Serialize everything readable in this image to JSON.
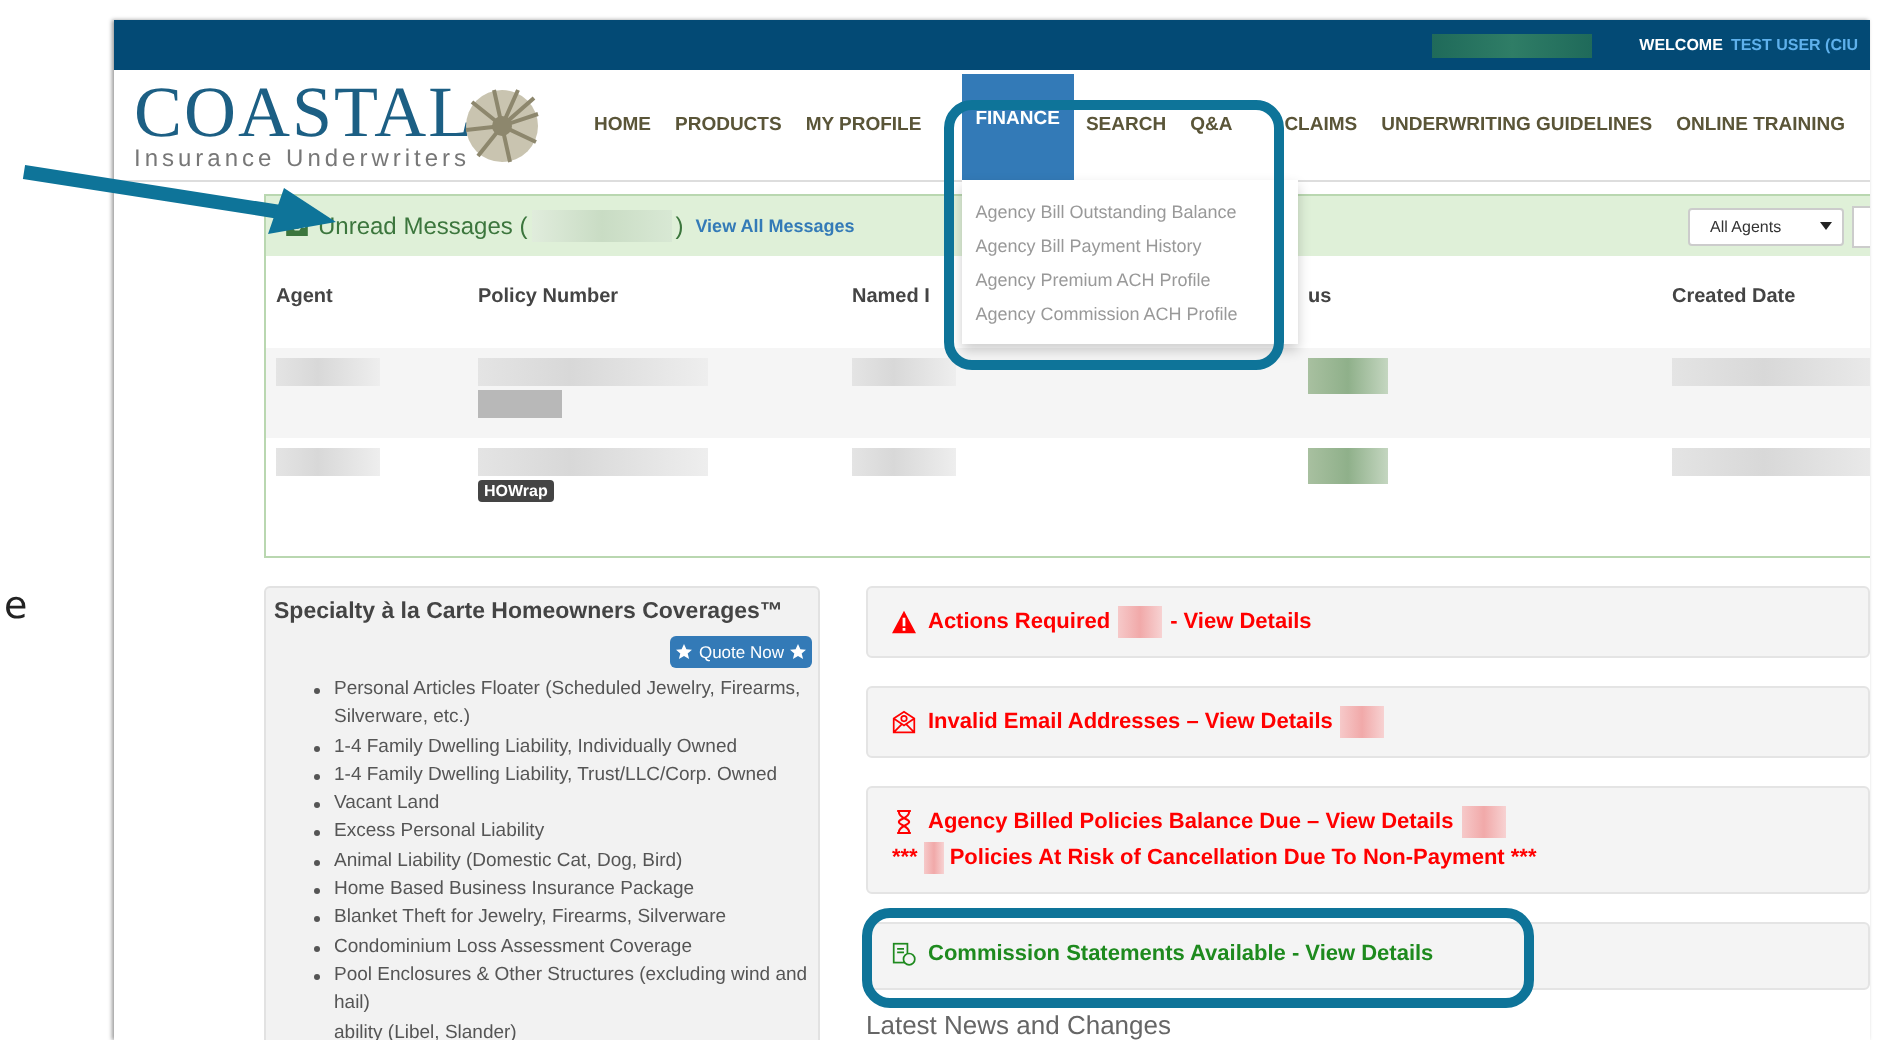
{
  "side_text": "e",
  "top_bar": {
    "welcome": "WELCOME",
    "user": "TEST USER (CIU"
  },
  "logo": {
    "name": "COASTAL",
    "tagline": "Insurance Underwriters"
  },
  "nav": [
    {
      "label": "HOME",
      "selected": false
    },
    {
      "label": "PRODUCTS",
      "selected": false
    },
    {
      "label": "MY PROFILE",
      "selected": false
    },
    {
      "label": "FINANCE",
      "selected": true,
      "menu": [
        "Agency Bill Outstanding Balance",
        "Agency Bill Payment History",
        "Agency Premium ACH Profile",
        "Agency Commission ACH Profile"
      ]
    },
    {
      "label": "SEARCH",
      "selected": false
    },
    {
      "label": "Q&A",
      "selected": false
    },
    {
      "label": "CLAIMS",
      "selected": false
    },
    {
      "label": "UNDERWRITING GUIDELINES",
      "selected": false
    },
    {
      "label": "ONLINE TRAINING",
      "selected": false
    }
  ],
  "messages": {
    "title_open": "Unread Messages (",
    "title_close": ")",
    "link": "View All Messages",
    "filter": "All Agents",
    "columns": [
      "Agent",
      "Policy Number",
      "Named I",
      "us",
      "Created Date"
    ],
    "rows": [
      {
        "policy_wrapped": true
      },
      {
        "policy_wrapped": false,
        "tag": "HOWrap"
      }
    ]
  },
  "coverages": {
    "title": "Specialty à la Carte Homeowners Coverages™",
    "button": "Quote Now",
    "items": [
      {
        "text": "Personal Articles Floater (Scheduled Jewelry, Firearms, Silverware, etc.)",
        "cut": false
      },
      {
        "text": "1-4 Family Dwelling Liability, Individually Owned",
        "cut": false
      },
      {
        "text": "1-4 Family Dwelling Liability, Trust/LLC/Corp. Owned",
        "cut": false
      },
      {
        "text": "Vacant Land",
        "cut": false
      },
      {
        "text": "Excess Personal Liability",
        "cut": false
      },
      {
        "text": "Animal Liability (Domestic Cat, Dog, Bird)",
        "cut": false
      },
      {
        "text": "Home Based Business Insurance Package",
        "cut": false
      },
      {
        "text": "Blanket Theft for Jewelry, Firearms, Silverware",
        "cut": false
      },
      {
        "text": "Condominium Loss Assessment Coverage",
        "cut": false
      },
      {
        "text": "Pool Enclosures & Other Structures (excluding wind and hail)",
        "cut": false
      },
      {
        "text": "ability (Libel, Slander)",
        "cut": true
      }
    ]
  },
  "alerts": [
    {
      "kind": "warning",
      "color": "#ff0000",
      "segments": [
        {
          "kind": "text",
          "text": "Actions Required"
        },
        {
          "kind": "redacted"
        },
        {
          "kind": "text",
          "text": "- View Details"
        }
      ]
    },
    {
      "kind": "email",
      "color": "#ff0000",
      "segments": [
        {
          "kind": "text",
          "text": "Invalid Email Addresses – View Details"
        },
        {
          "kind": "redacted"
        }
      ]
    },
    {
      "kind": "hourglass",
      "color": "#ff0000",
      "segments": [
        {
          "kind": "text",
          "text": "Agency Billed Policies Balance Due – View Details"
        },
        {
          "kind": "redacted"
        }
      ],
      "subline": [
        {
          "kind": "text",
          "text": "***"
        },
        {
          "kind": "redacted"
        },
        {
          "kind": "text",
          "text": "Policies At Risk of Cancellation Due To Non-Payment ***"
        }
      ]
    },
    {
      "kind": "commission",
      "color": "#1e8a1e",
      "segments": [
        {
          "kind": "text",
          "text": "Commission Statements Available - View Details"
        }
      ]
    }
  ],
  "news_title": "Latest News and Changes"
}
